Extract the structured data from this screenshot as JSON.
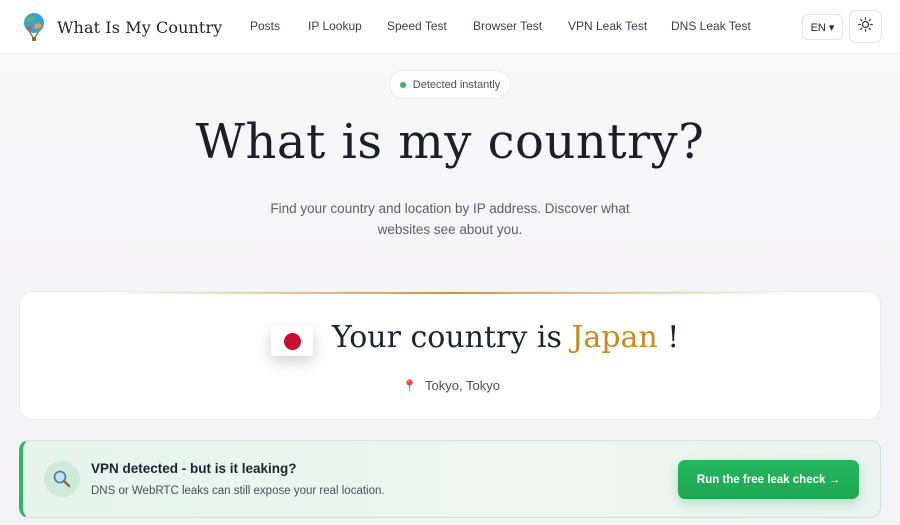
{
  "header": {
    "brand_name": "What Is My Country",
    "nav": [
      "Posts",
      "IP Lookup",
      "Speed Test",
      "Browser Test",
      "VPN Leak Test",
      "DNS Leak Test"
    ],
    "language": "EN ▾",
    "theme_icon": "sun-icon"
  },
  "hero": {
    "badge": "Detected instantly",
    "title": "What is my country?",
    "subtitle": "Find your country and location by IP address. Discover what websites see about you."
  },
  "result": {
    "flag_icon": "japan-flag-icon",
    "prefix": "Your country is",
    "country": "Japan",
    "suffix": "!",
    "location": "Tokyo, Tokyo",
    "accent_color": "#c98a1e"
  },
  "vpn_banner": {
    "icon": "magnifier-icon",
    "title": "VPN detected - but is it leaking?",
    "description": "DNS or WebRTC leaks can still expose your real location.",
    "cta": "Run the free leak check →",
    "accent_color": "#2fb866"
  }
}
